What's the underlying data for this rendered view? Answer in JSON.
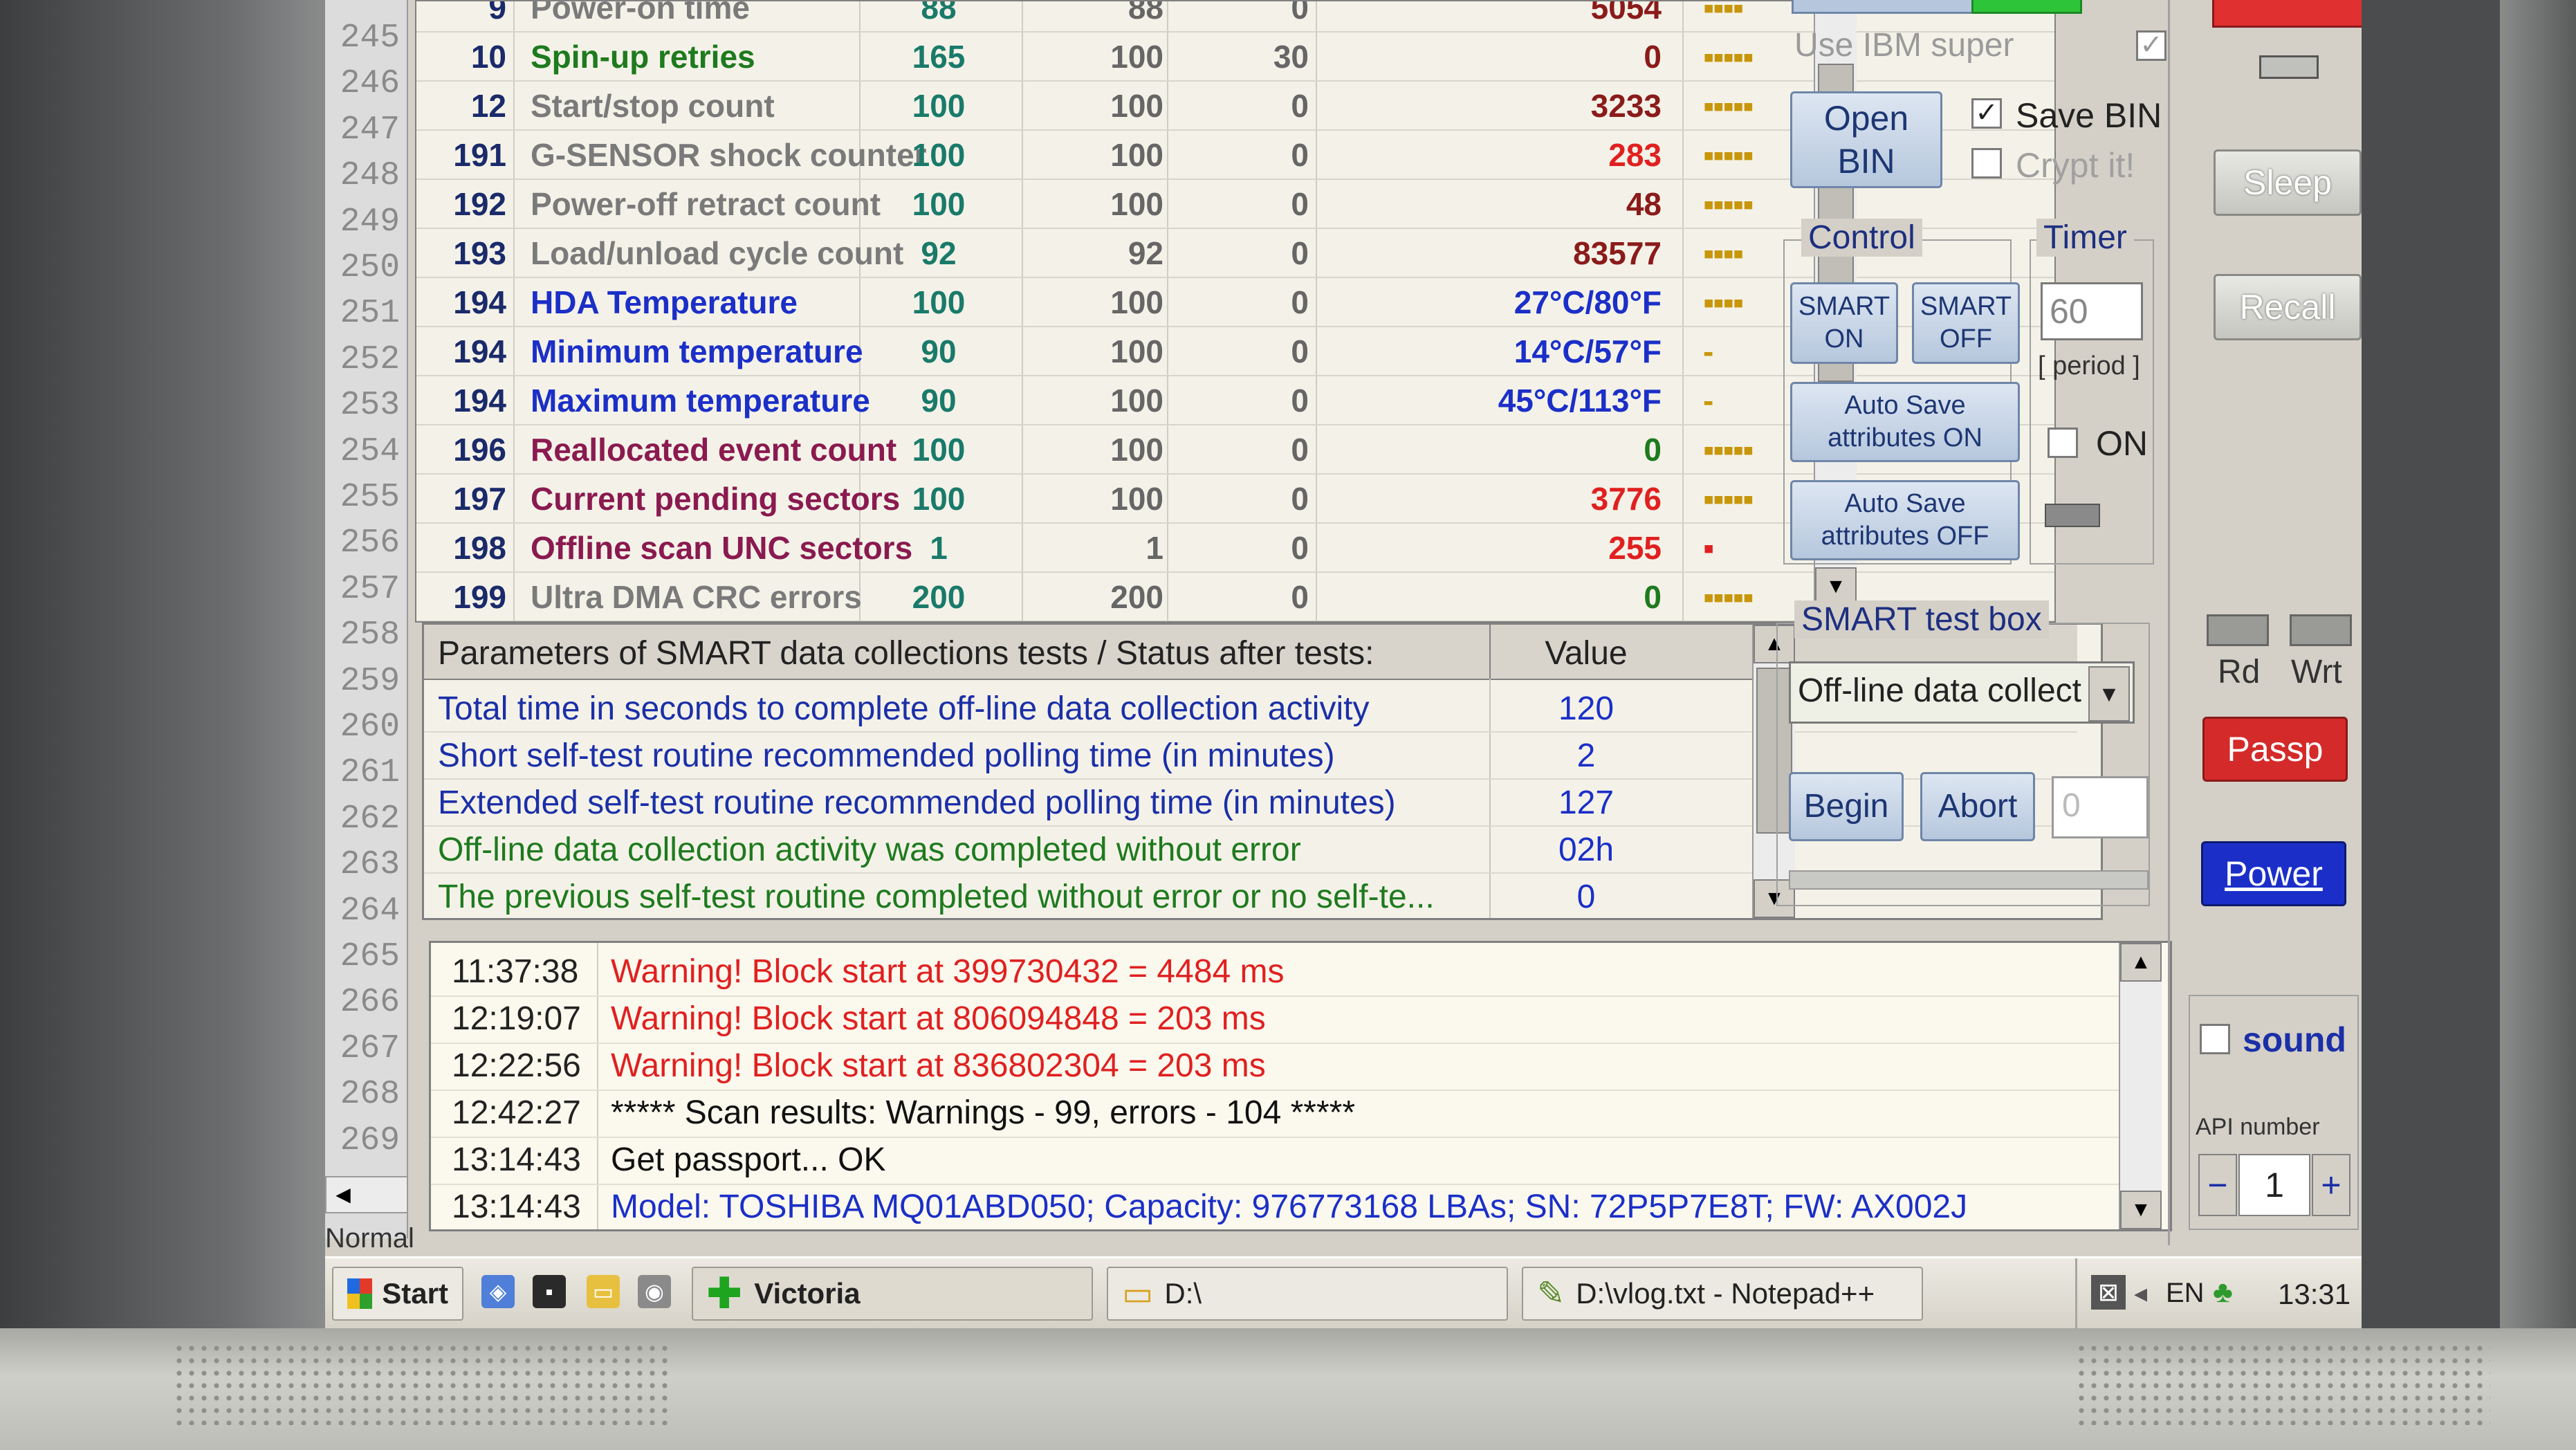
{
  "gutter": {
    "lines": [
      "245",
      "246",
      "247",
      "248",
      "249",
      "250",
      "251",
      "252",
      "253",
      "254",
      "255",
      "256",
      "257",
      "258",
      "259",
      "260",
      "261",
      "262",
      "263",
      "264",
      "265",
      "266",
      "267",
      "268",
      "269"
    ],
    "status": "Normal t"
  },
  "smart_table": {
    "rows": [
      {
        "id": "9",
        "name": "Power-on time",
        "value": "88",
        "worst": "88",
        "threshold": "0",
        "raw": "5054",
        "health": "▪▪▪▪",
        "name_color": "#7a7a7a",
        "raw_color": "#8b1b1b"
      },
      {
        "id": "10",
        "name": "Spin-up retries",
        "value": "165",
        "worst": "100",
        "threshold": "30",
        "raw": "0",
        "health": "▪▪▪▪▪",
        "name_color": "#1e7a1e",
        "raw_color": "#8b1b1b"
      },
      {
        "id": "12",
        "name": "Start/stop count",
        "value": "100",
        "worst": "100",
        "threshold": "0",
        "raw": "3233",
        "health": "▪▪▪▪▪",
        "name_color": "#7a7a7a",
        "raw_color": "#8b1b1b"
      },
      {
        "id": "191",
        "name": "G-SENSOR shock counter",
        "value": "100",
        "worst": "100",
        "threshold": "0",
        "raw": "283",
        "health": "▪▪▪▪▪",
        "name_color": "#7a7a7a",
        "raw_color": "#e02020"
      },
      {
        "id": "192",
        "name": "Power-off retract count",
        "value": "100",
        "worst": "100",
        "threshold": "0",
        "raw": "48",
        "health": "▪▪▪▪▪",
        "name_color": "#7a7a7a",
        "raw_color": "#8b1b1b"
      },
      {
        "id": "193",
        "name": "Load/unload cycle count",
        "value": "92",
        "worst": "92",
        "threshold": "0",
        "raw": "83577",
        "health": "▪▪▪▪",
        "name_color": "#7a7a7a",
        "raw_color": "#8b1b1b"
      },
      {
        "id": "194",
        "name": "HDA Temperature",
        "value": "100",
        "worst": "100",
        "threshold": "0",
        "raw": "27°C/80°F",
        "health": "▪▪▪▪",
        "name_color": "#1b2fc8",
        "raw_color": "#1b2fc8"
      },
      {
        "id": "194",
        "name": "Minimum temperature",
        "value": "90",
        "worst": "100",
        "threshold": "0",
        "raw": "14°C/57°F",
        "health": "-",
        "name_color": "#1b2fc8",
        "raw_color": "#1b2fc8"
      },
      {
        "id": "194",
        "name": "Maximum temperature",
        "value": "90",
        "worst": "100",
        "threshold": "0",
        "raw": "45°C/113°F",
        "health": "-",
        "name_color": "#1b2fc8",
        "raw_color": "#1b2fc8"
      },
      {
        "id": "196",
        "name": "Reallocated event count",
        "value": "100",
        "worst": "100",
        "threshold": "0",
        "raw": "0",
        "health": "▪▪▪▪▪",
        "name_color": "#8a1a50",
        "raw_color": "#1e7a1e"
      },
      {
        "id": "197",
        "name": "Current pending sectors",
        "value": "100",
        "worst": "100",
        "threshold": "0",
        "raw": "3776",
        "health": "▪▪▪▪▪",
        "name_color": "#8a1a50",
        "raw_color": "#e02020"
      },
      {
        "id": "198",
        "name": "Offline scan UNC sectors",
        "value": "1",
        "worst": "1",
        "threshold": "0",
        "raw": "255",
        "health": "▪",
        "name_color": "#8a1a50",
        "raw_color": "#e02020"
      },
      {
        "id": "199",
        "name": "Ultra DMA CRC errors",
        "value": "200",
        "worst": "200",
        "threshold": "0",
        "raw": "0",
        "health": "▪▪▪▪▪",
        "name_color": "#7a7a7a",
        "raw_color": "#1e7a1e"
      }
    ]
  },
  "params": {
    "header": "Parameters of SMART data collections tests / Status after tests:",
    "value_header": "Value",
    "rows": [
      {
        "label": "Total time in seconds to complete off-line data collection activity",
        "value": "120",
        "color": "#1b2fa8"
      },
      {
        "label": "Short self-test routine recommended polling time (in minutes)",
        "value": "2",
        "color": "#1b2fa8"
      },
      {
        "label": "Extended self-test routine recommended polling time (in minutes)",
        "value": "127",
        "color": "#1b2fa8"
      },
      {
        "label": "Off-line data collection activity was completed without error",
        "value": "02h",
        "color": "#1e7a1e"
      },
      {
        "label": "The previous self-test routine completed without error or no self-te...",
        "value": "0",
        "color": "#1e7a1e"
      }
    ]
  },
  "log": [
    {
      "time": "11:37:38",
      "msg": "Warning! Block start at 399730432 = 4484 ms",
      "color": "#e02020"
    },
    {
      "time": "12:19:07",
      "msg": "Warning! Block start at 806094848 = 203 ms",
      "color": "#e02020"
    },
    {
      "time": "12:22:56",
      "msg": "Warning! Block start at 836802304 = 203 ms",
      "color": "#e02020"
    },
    {
      "time": "12:42:27",
      "msg": "***** Scan results: Warnings - 99, errors - 104 *****",
      "color": "#111111"
    },
    {
      "time": "13:14:43",
      "msg": "Get passport... OK",
      "color": "#111111"
    },
    {
      "time": "13:14:43",
      "msg": "Model: TOSHIBA MQ01ABD050; Capacity: 976773168 LBAs; SN: 72P5P7E8T; FW: AX002J",
      "color": "#1b2fc8"
    }
  ],
  "side": {
    "use_ibm": "Use IBM super",
    "open_bin": "Open BIN",
    "save_bin": "Save BIN",
    "crypt": "Crypt it!",
    "control": "Control",
    "timer": "Timer",
    "smart_on": "SMART ON",
    "smart_off": "SMART OFF",
    "autosave_on": "Auto Save attributes ON",
    "autosave_off": "Auto Save attributes OFF",
    "timer_value": "60",
    "period": "[ period ]",
    "on_label": "ON",
    "testbox": "SMART test box",
    "test_select": "Off-line data collect",
    "begin": "Begin",
    "abort": "Abort",
    "test_field": "0"
  },
  "right": {
    "sleep": "Sleep",
    "recall": "Recall",
    "rd": "Rd",
    "wrt": "Wrt",
    "passp": "Passp",
    "power": "Power",
    "sound": "sound",
    "api_label": "API number",
    "api_value": "1",
    "minus": "−",
    "plus": "+"
  },
  "taskbar": {
    "start": "Start",
    "victoria": "Victoria",
    "drive": "D:\\",
    "notepad": "D:\\vlog.txt - Notepad++",
    "lang": "EN",
    "clock": "13:31"
  },
  "colors": {
    "passp_bg": "#d42a2a",
    "power_bg": "#1b2fc8",
    "top_red": "#e03030",
    "top_green": "#2ec43a"
  }
}
